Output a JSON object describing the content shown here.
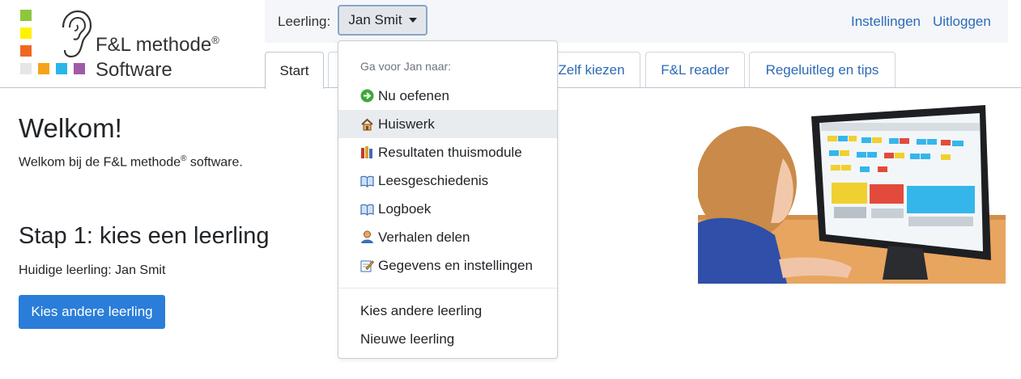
{
  "logo": {
    "line1": "F&L methode",
    "registered": "®",
    "line2": "Software",
    "colors": [
      "#8dc63f",
      "#fff200",
      "#f26522",
      "#e6e6e6",
      "#f7a21b",
      "#29b6e8",
      "#a05aa8"
    ]
  },
  "topbar": {
    "leerling_label": "Leerling:",
    "selected_student": "Jan Smit",
    "settings_link": "Instellingen",
    "logout_link": "Uitloggen"
  },
  "tabs": [
    {
      "label": "Start",
      "active": true
    },
    {
      "label": "Zelf kiezen",
      "active": false
    },
    {
      "label": "F&L reader",
      "active": false
    },
    {
      "label": "Regeluitleg en tips",
      "active": false
    }
  ],
  "dropdown": {
    "header": "Ga voor Jan naar:",
    "items": [
      {
        "label": "Nu oefenen",
        "icon": "arrow-right-icon"
      },
      {
        "label": "Huiswerk",
        "icon": "house-icon"
      },
      {
        "label": "Resultaten thuismodule",
        "icon": "books-icon"
      },
      {
        "label": "Leesgeschiedenis",
        "icon": "book-icon"
      },
      {
        "label": "Logboek",
        "icon": "book-icon"
      },
      {
        "label": "Verhalen delen",
        "icon": "user-icon"
      },
      {
        "label": "Gegevens en instellingen",
        "icon": "edit-icon"
      }
    ],
    "actions": [
      {
        "label": "Kies andere leerling"
      },
      {
        "label": "Nieuwe leerling"
      }
    ]
  },
  "main": {
    "welcome_title": "Welkom!",
    "welcome_text": "Welkom bij de F&L methode",
    "welcome_registered": "®",
    "welcome_text_end": " software.",
    "step_title": "Stap 1: kies een leerling",
    "current_student": "Huidige leerling: Jan Smit",
    "choose_button": "Kies andere leerling"
  },
  "colors": {
    "link": "#2d6ab6",
    "primary_button": "#2a7dd9",
    "hover_item": "#e9ecef"
  }
}
